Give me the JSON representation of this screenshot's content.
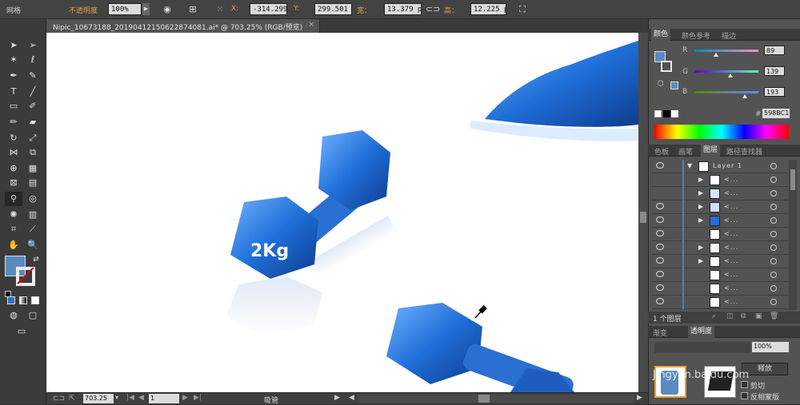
{
  "control_bar": {
    "mode_label": "网格",
    "opacity_label": "不透明度",
    "opacity_value": "100%",
    "x_label": "X:",
    "x_value": "-314.299",
    "y_label": "Y:",
    "y_value": "299.501 p",
    "width_label": "宽：",
    "width_value": "13.379 px",
    "height_label": "高：",
    "height_value": "12.225 px"
  },
  "document": {
    "tab_title": "Nipic_10673188_20190412150622874081.ai* @ 703.25% (RGB/预览)",
    "close_glyph": "×",
    "canvas_text": "2Kg"
  },
  "status_bar": {
    "zoom": "703.25",
    "page": "1",
    "tool_name": "吸管"
  },
  "color_panel": {
    "tabs": [
      "颜色",
      "颜色参考",
      "描边"
    ],
    "r_label": "R",
    "g_label": "G",
    "b_label": "B",
    "r_value": "89",
    "g_value": "139",
    "b_value": "193",
    "hex_label": "#",
    "hex_value": "598BC1",
    "fill_color": "#598BC1"
  },
  "layers_panel": {
    "tabs": [
      "色板",
      "画笔",
      "图层",
      "路径查找器"
    ],
    "layer_name": "Layer 1",
    "sublayer_label": "<...",
    "footer_text": "1 个图层"
  },
  "transparency_panel": {
    "tab_label": "渐变",
    "tab2_label": "透明度",
    "opacity_value": "100%",
    "release_button": "释放",
    "clip_label": "剪切",
    "invert_label": "反相蒙版",
    "watermark": "Jingyan.baidu.com"
  }
}
